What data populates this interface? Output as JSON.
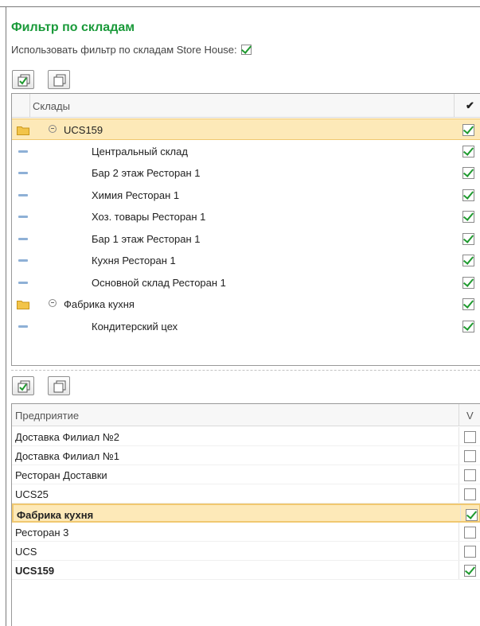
{
  "title": "Фильтр по складам",
  "use_filter": {
    "label": "Использовать фильтр по складам Store House:",
    "checked": true
  },
  "toolbar_top": {
    "check_all_icon": "check-all-icon",
    "uncheck_all_icon": "uncheck-all-icon"
  },
  "warehouses": {
    "header_label": "Склады",
    "header_mark": "✔",
    "rows": [
      {
        "label": "UCS159",
        "type": "group",
        "checked": true,
        "selected": true
      },
      {
        "label": "Центральный склад",
        "type": "child",
        "checked": true
      },
      {
        "label": "Бар 2 этаж Ресторан 1",
        "type": "child",
        "checked": true
      },
      {
        "label": "Химия Ресторан 1",
        "type": "child",
        "checked": true
      },
      {
        "label": "Хоз. товары Ресторан 1",
        "type": "child",
        "checked": true
      },
      {
        "label": "Бар 1 этаж Ресторан 1",
        "type": "child",
        "checked": true
      },
      {
        "label": "Кухня Ресторан 1",
        "type": "child",
        "checked": true
      },
      {
        "label": "Основной склад Ресторан 1",
        "type": "child",
        "checked": true
      },
      {
        "label": "Фабрика кухня",
        "type": "group",
        "checked": true
      },
      {
        "label": "Кондитерский цех",
        "type": "child",
        "checked": true
      }
    ]
  },
  "enterprises": {
    "header_label": "Предприятие",
    "header_v": "V",
    "rows": [
      {
        "label": "Доставка Филиал №2",
        "checked": false
      },
      {
        "label": "Доставка Филиал №1",
        "checked": false
      },
      {
        "label": "Ресторан Доставки",
        "checked": false
      },
      {
        "label": "UCS25",
        "checked": false
      },
      {
        "label": "Фабрика кухня",
        "checked": true,
        "bold": true,
        "selected": true
      },
      {
        "label": "Ресторан 3",
        "checked": false
      },
      {
        "label": "UCS",
        "checked": false
      },
      {
        "label": "UCS159",
        "checked": true,
        "bold": true
      }
    ]
  },
  "colors": {
    "title": "#1a9a3a",
    "check": "#1f9a2f",
    "selection": "#fde9b8",
    "folder": "#f2c44a"
  }
}
